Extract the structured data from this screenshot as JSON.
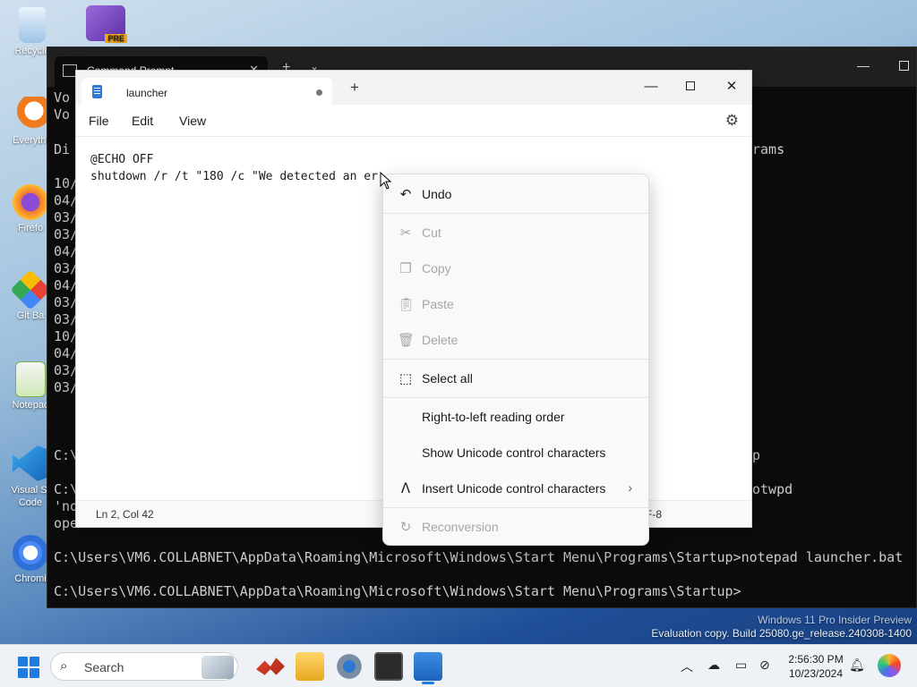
{
  "desktop": {
    "icons": [
      {
        "label": "Recycle",
        "icon": "recycle-bin-icon"
      },
      {
        "label": "",
        "icon": "visual-studio-preview-icon",
        "badge": "PRE"
      },
      {
        "label": "Everythi",
        "icon": "everything-search-icon"
      },
      {
        "label": "Firefo",
        "icon": "firefox-icon"
      },
      {
        "label": "Git Ba",
        "icon": "git-bash-icon"
      },
      {
        "label": "Notepac",
        "icon": "notepad-plus-plus-icon"
      },
      {
        "label": "Visual St\nCode",
        "icon": "vscode-icon"
      },
      {
        "label": "Chromi",
        "icon": "chromium-icon"
      }
    ],
    "watermark_line1": "Windows 11 Pro Insider Preview",
    "watermark_line2": "Evaluation copy. Build 25080.ge_release.240308-1400"
  },
  "terminal": {
    "tab_title": "Command Prompt",
    "lines_left": [
      "Vo",
      "Vo",
      "Di",
      "10/",
      "04/",
      "03/",
      "03/",
      "04/",
      "03/",
      "04/",
      "03/",
      "03/",
      "10/",
      "04/",
      "03/",
      "03/",
      "C:\\",
      "C:\\",
      "'no",
      "ope"
    ],
    "right_fragments": [
      "rams",
      "p",
      "otwpd"
    ],
    "line_prompt1": "C:\\Users\\VM6.COLLABNET\\AppData\\Roaming\\Microsoft\\Windows\\Start Menu\\Programs\\Startup>notepad launcher.bat",
    "line_prompt2": "C:\\Users\\VM6.COLLABNET\\AppData\\Roaming\\Microsoft\\Windows\\Start Menu\\Programs\\Startup>",
    "colors": {
      "bg": "#0c0c0c",
      "text": "#cccccc"
    }
  },
  "notepad": {
    "tab_title": "launcher",
    "menu": [
      "File",
      "Edit",
      "View"
    ],
    "content": [
      "@ECHO OFF",
      "shutdown /r /t \"180 /c \"We detected an er"
    ],
    "status": {
      "position": "Ln 2, Col 42",
      "encoding": "F-8"
    }
  },
  "context_menu": {
    "items": [
      {
        "label": "Undo",
        "icon": "undo-icon",
        "enabled": true
      },
      {
        "label": "Cut",
        "icon": "scissors-icon",
        "enabled": false
      },
      {
        "label": "Copy",
        "icon": "copy-icon",
        "enabled": false
      },
      {
        "label": "Paste",
        "icon": "clipboard-icon",
        "enabled": false
      },
      {
        "label": "Delete",
        "icon": "trash-icon",
        "enabled": false
      },
      {
        "label": "Select all",
        "icon": "select-all-icon",
        "enabled": true
      },
      {
        "label": "Right-to-left reading order",
        "icon": "",
        "enabled": true
      },
      {
        "label": "Show Unicode control characters",
        "icon": "",
        "enabled": true
      },
      {
        "label": "Insert Unicode control characters",
        "icon": "insert-caret-icon",
        "enabled": true,
        "submenu": true
      },
      {
        "label": "Reconversion",
        "icon": "reconversion-icon",
        "enabled": false
      }
    ]
  },
  "taskbar": {
    "search_label": "Search",
    "clock_time": "2:56:30 PM",
    "clock_date": "10/23/2024",
    "accent": "#1f7be0"
  }
}
